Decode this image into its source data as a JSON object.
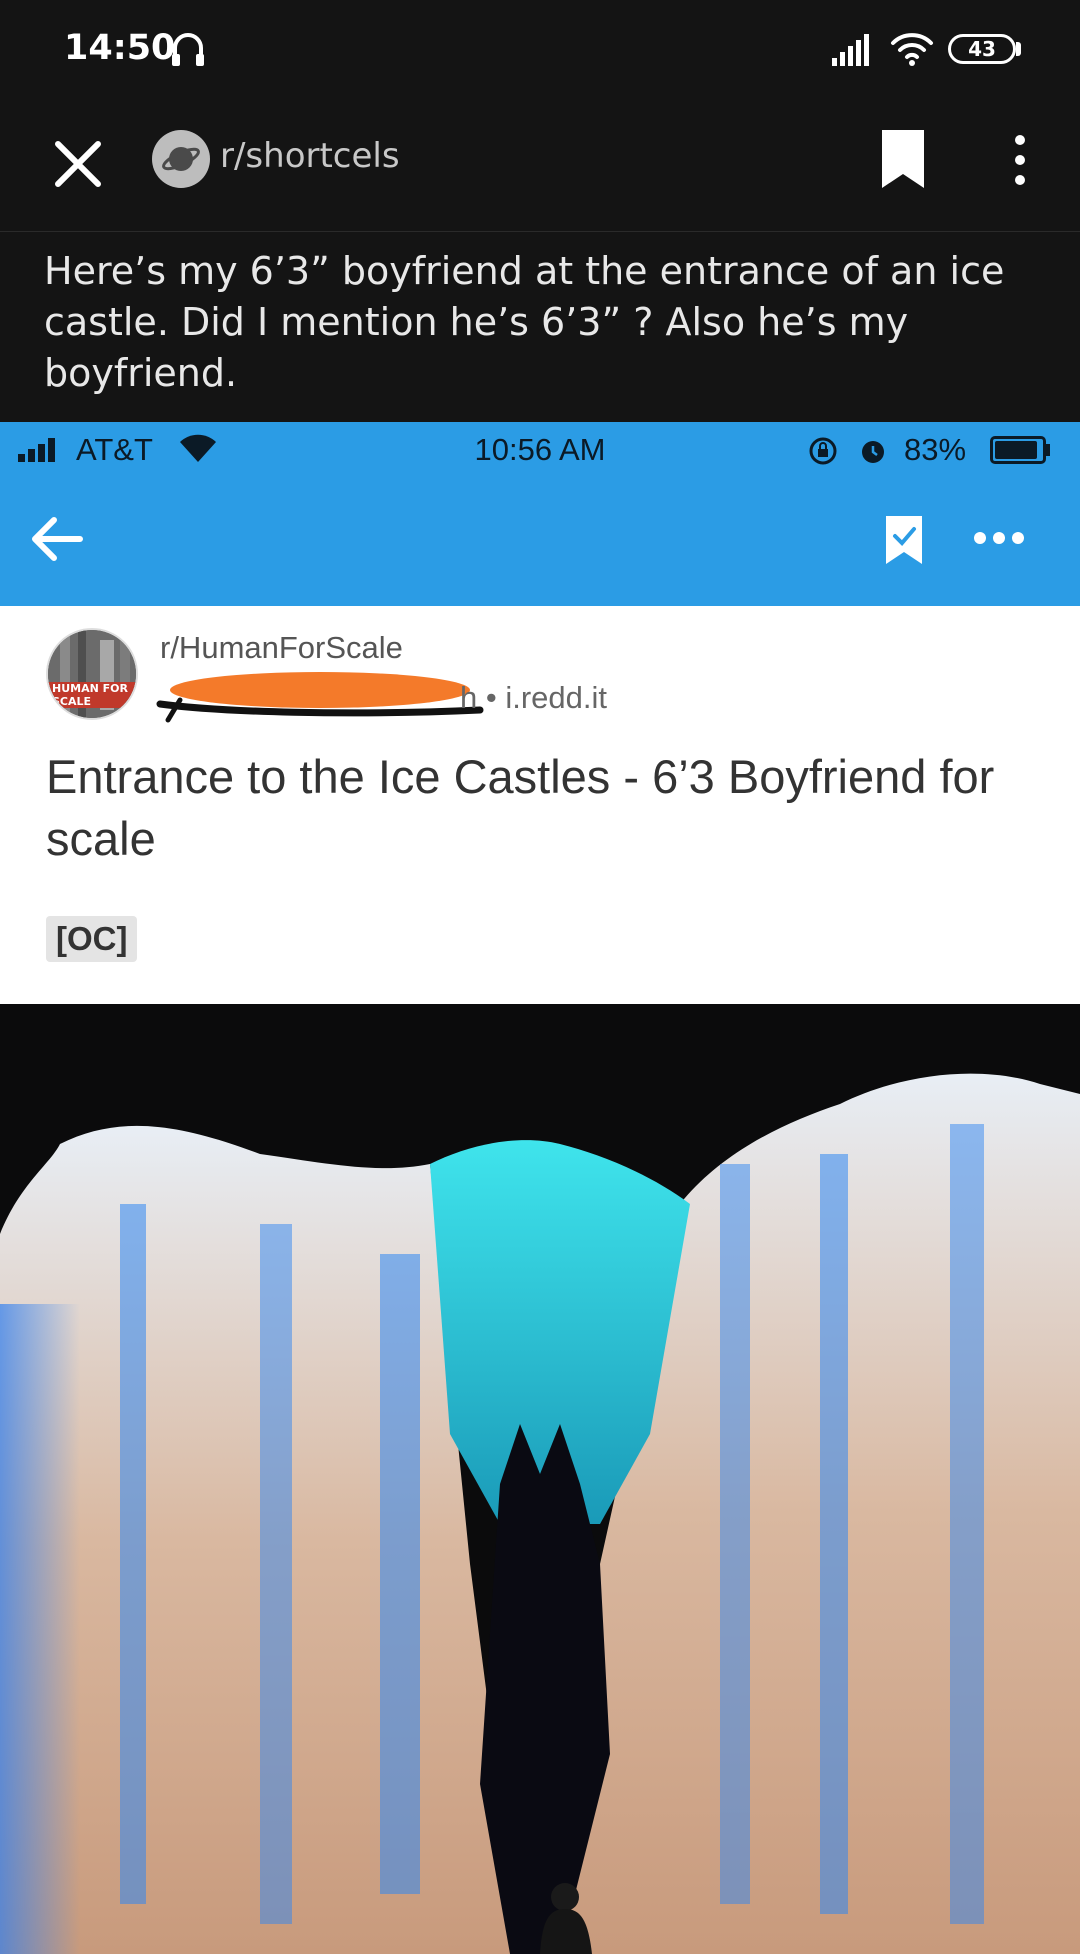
{
  "status_bar": {
    "time": "14:50",
    "battery": "43",
    "icons": [
      "headset-icon",
      "signal-icon",
      "wifi-icon",
      "battery-icon"
    ]
  },
  "toolbar": {
    "subreddit": "r/shortcels",
    "icons": [
      "close-icon",
      "subreddit-icon",
      "bookmark-icon",
      "more-vertical-icon"
    ]
  },
  "post": {
    "title": "Here’s my 6’3” boyfriend at the entrance of an ice castle. Did I mention he’s 6’3” ? Also he’s my boyfriend."
  },
  "screenshot": {
    "status_bar": {
      "carrier": "AT&T",
      "time": "10:56 AM",
      "battery": "83%",
      "icons": [
        "signal-icon",
        "wifi-icon",
        "rotation-lock-icon",
        "alarm-icon",
        "battery-icon"
      ]
    },
    "toolbar": {
      "icons": [
        "back-arrow-icon",
        "saved-bookmark-icon",
        "more-horizontal-icon"
      ]
    },
    "post": {
      "subreddit": "r/HumanForScale",
      "avatar_text": "HUMAN FOR SCALE",
      "meta": "h • i.redd.it",
      "title": "Entrance to the Ice Castles - 6’3 Boyfriend for scale",
      "flair": "[OC]"
    },
    "image": {
      "subject": "ice-castle-photo"
    }
  },
  "colors": {
    "outer_background": "#141414",
    "inner_accent": "#2b9ce5",
    "redaction_orange": "#f47a2a"
  }
}
